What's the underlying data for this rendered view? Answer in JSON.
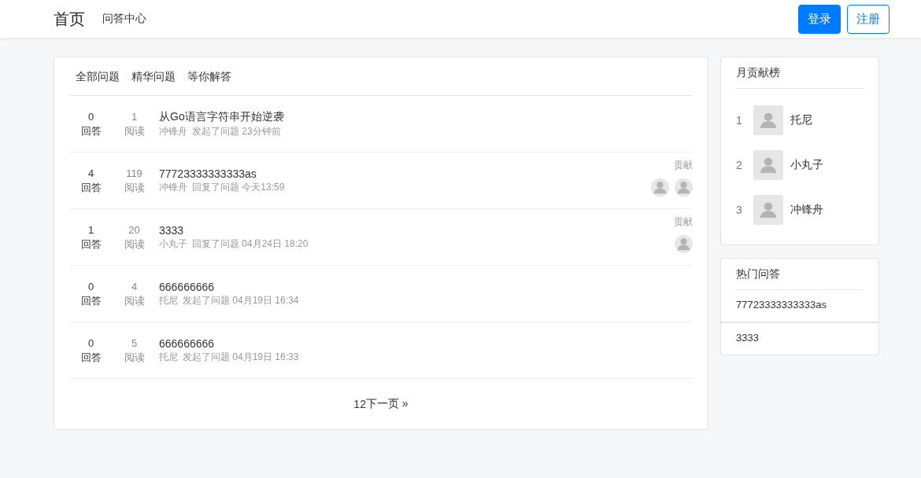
{
  "header": {
    "brand": "首页",
    "nav": [
      "问答中心"
    ],
    "buttons": [
      {
        "label": "登录",
        "kind": "primary"
      },
      {
        "label": "注册",
        "kind": "outline"
      }
    ]
  },
  "tabs": [
    {
      "label": "全部问题",
      "selected": false
    },
    {
      "label": "精华问题",
      "selected": false
    },
    {
      "label": "等你解答",
      "selected": false
    }
  ],
  "questions": [
    {
      "answers": "0",
      "answers_label": "回答",
      "views": "1",
      "views_label": "阅读",
      "title": "从Go语言字符串开始逆袭",
      "user": "冲锋舟",
      "action": "发起了问题",
      "time": "23分钟前"
    },
    {
      "answers": "4",
      "answers_label": "回答",
      "views": "119",
      "views_label": "阅读",
      "title": "77723333333333as",
      "user": "冲锋舟",
      "action": "回复了问题",
      "time": "今天13:59",
      "contrib_label": "贡献",
      "contributors": [
        {
          "kind": "avatar"
        },
        {
          "kind": "avatar"
        }
      ]
    },
    {
      "answers": "1",
      "answers_label": "回答",
      "views": "20",
      "views_label": "阅读",
      "title": "3333",
      "user": "小丸子",
      "action": "回复了问题",
      "time": "04月24日 18:20",
      "contrib_label": "贡献",
      "contributors": [
        {
          "kind": "avatar"
        }
      ]
    },
    {
      "answers": "0",
      "answers_label": "回答",
      "views": "4",
      "views_label": "阅读",
      "title": "666666666",
      "user": "托尼",
      "action": "发起了问题",
      "time": "04月19日 16:34"
    },
    {
      "answers": "0",
      "answers_label": "回答",
      "views": "5",
      "views_label": "阅读",
      "title": "666666666",
      "user": "托尼",
      "action": "发起了问题",
      "time": "04月19日 16:33"
    }
  ],
  "pagination": [
    "1",
    "2",
    "下一页 »"
  ],
  "leaderboard": {
    "title": "月贡献榜",
    "items": [
      {
        "rank": "1",
        "name": "托尼"
      },
      {
        "rank": "2",
        "name": "小丸子"
      },
      {
        "rank": "3",
        "name": "冲锋舟"
      }
    ]
  },
  "hot": {
    "title": "热门问答",
    "items": [
      "77723333333333as",
      "3333"
    ]
  }
}
